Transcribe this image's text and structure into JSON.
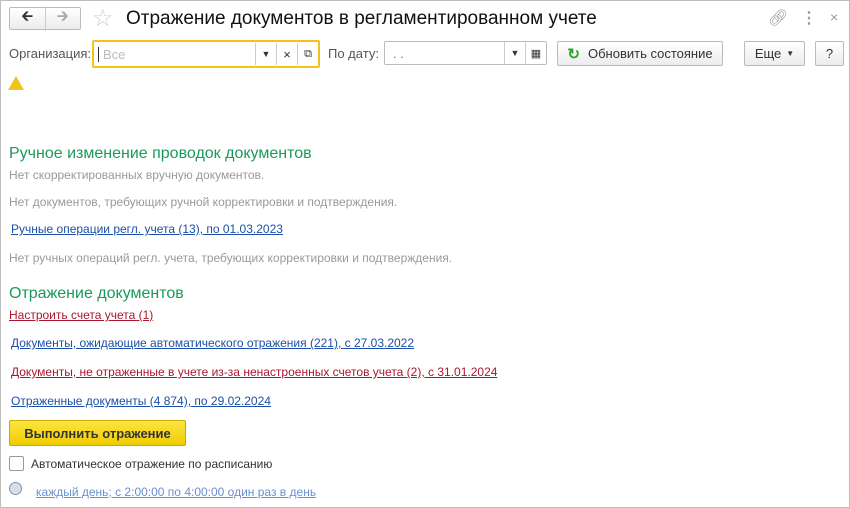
{
  "header": {
    "title": "Отражение документов в регламентированном учете"
  },
  "filters": {
    "org_label": "Организация:",
    "org_placeholder": "Все",
    "date_label": "По дату:",
    "date_value": " .  .",
    "refresh_label": "Обновить состояние",
    "more_label": "Еще",
    "help_label": "?"
  },
  "manual": {
    "title": "Ручное изменение проводок документов",
    "line1": "Нет скорректированных вручную документов.",
    "line2": "Нет документов, требующих ручной корректировки и подтверждения.",
    "link": "Ручные операции регл. учета (13), по 01.03.2023",
    "line3": "Нет ручных операций регл. учета, требующих корректировки и подтверждения."
  },
  "reflection": {
    "title": "Отражение документов",
    "setup_link": "Настроить счета учета (1)",
    "pending_link": "Документы, ожидающие автоматического отражения (221), с 27.03.2022",
    "unreflected_link": "Документы, не отраженные в учете из-за ненастроенных счетов учета (2), с 31.01.2024",
    "reflected_link": "Отраженные документы (4 874), по 29.02.2024",
    "run_button": "Выполнить отражение",
    "auto_label": "Автоматическое отражение по расписанию",
    "auto_checked": false,
    "schedule_link": "каждый день; с 2:00:00 по 4:00:00 один раз в день"
  },
  "colors": {
    "accent_yellow": "#f5d000",
    "section_green": "#1a9a5a",
    "link_blue": "#1b4fa8",
    "link_red": "#a9172e"
  }
}
